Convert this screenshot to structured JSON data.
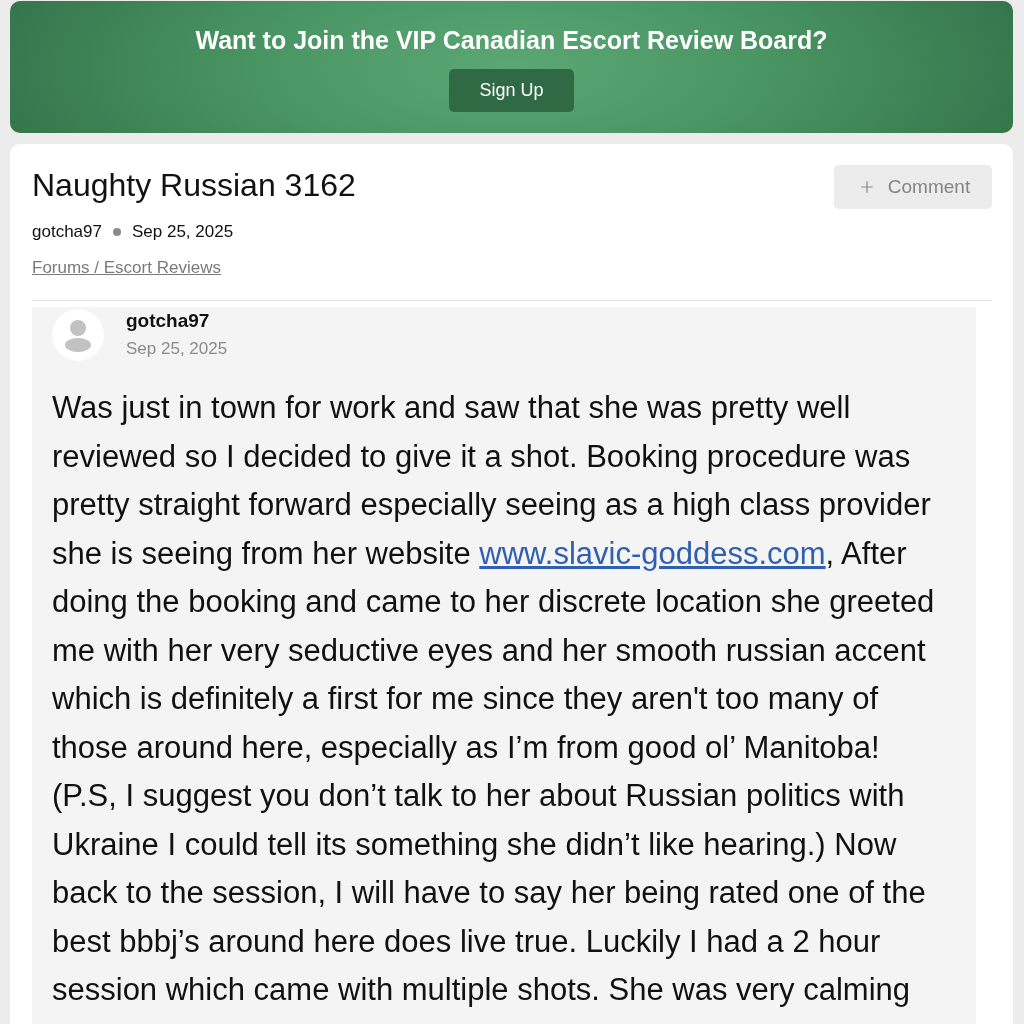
{
  "banner": {
    "title": "Want to Join the VIP Canadian Escort Review Board?",
    "button": "Sign Up"
  },
  "thread": {
    "title": "Naughty Russian 3162",
    "comment_button": "Comment",
    "author": "gotcha97",
    "date": "Sep 25, 2025",
    "breadcrumb": "Forums / Escort Reviews"
  },
  "post": {
    "author": "gotcha97",
    "date": "Sep 25, 2025",
    "body": [
      {
        "kind": "text",
        "text": "Was just in town for work and saw that she was pretty well reviewed so I decided to give it a shot. Booking procedure was pretty straight forward especially seeing as a high class provider she is seeing from her website "
      },
      {
        "kind": "link",
        "text": "www.slavic-goddess.com"
      },
      {
        "kind": "text",
        "text": ", After doing the booking and came to her discrete location she greeted me with her very seductive eyes and her smooth russian accent which is definitely a first for me since they aren't too many of those around here, especially as I’m from good ol’ Manitoba! (P.S, I suggest you don’t talk to her about Russian politics with Ukraine I could tell its something she didn’t like hearing.) Now back to the session, I will have to say her being rated one of the best bbbj’s around here does live true. Luckily I had a 2 hour session which came with multiple shots. She was very calming"
      }
    ]
  }
}
